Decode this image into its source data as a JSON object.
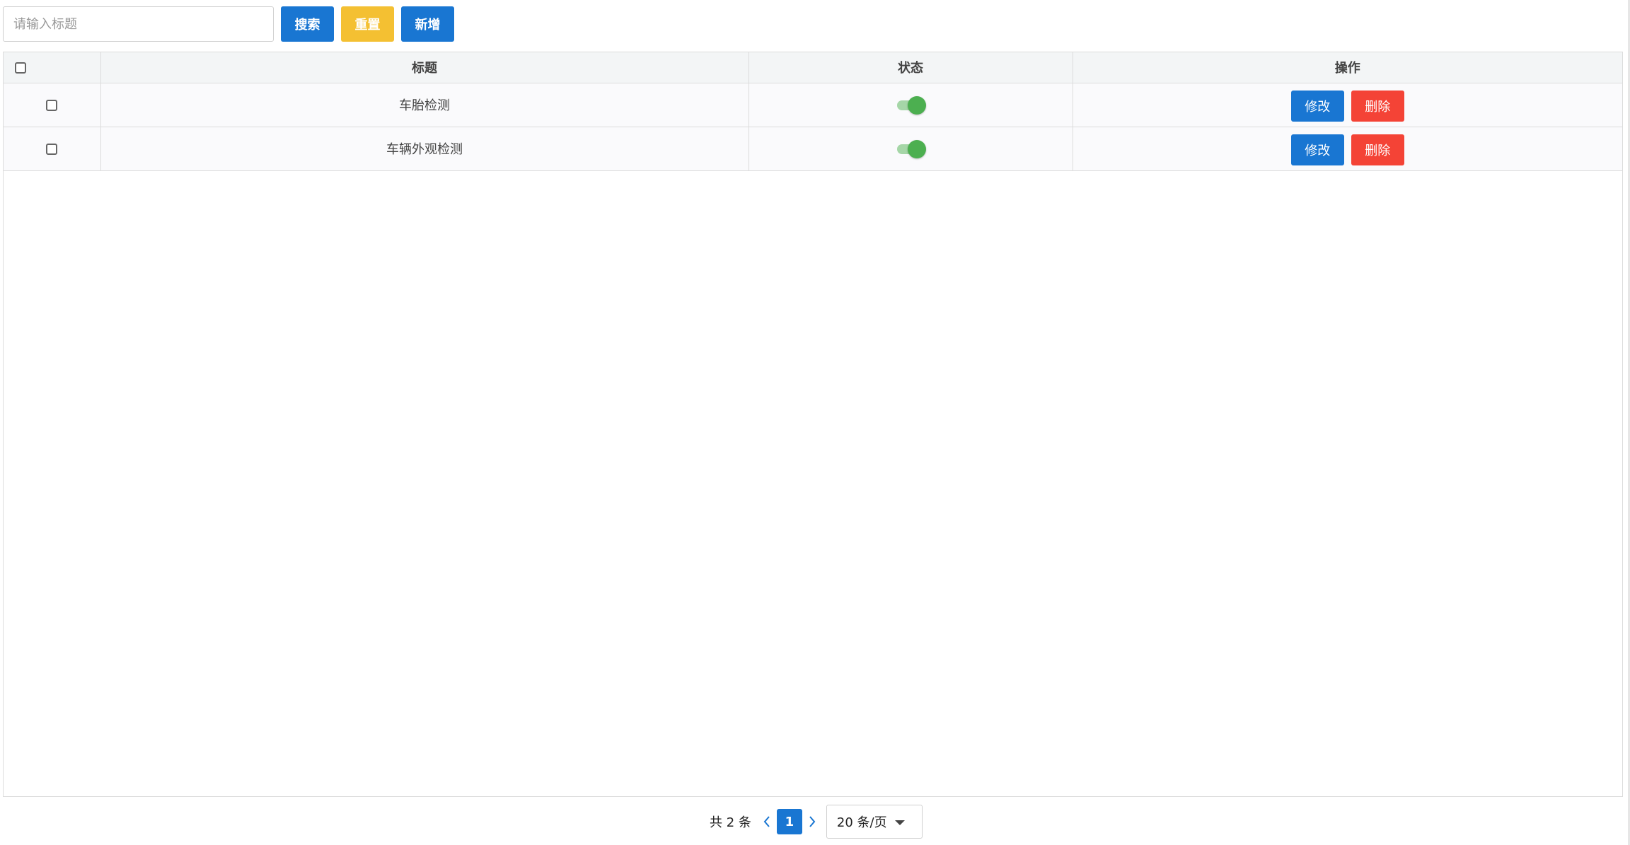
{
  "search": {
    "placeholder": "请输入标题",
    "value": ""
  },
  "toolbar": {
    "search_label": "搜索",
    "reset_label": "重置",
    "add_label": "新增"
  },
  "colors": {
    "primary": "#1976d2",
    "warning": "#f4c032",
    "danger": "#f44336",
    "switch_on": "#4caf50"
  },
  "table": {
    "columns": {
      "title": "标题",
      "status": "状态",
      "actions": "操作"
    },
    "rows": [
      {
        "checked": false,
        "title": "车胎检测",
        "status_on": true,
        "edit_label": "修改",
        "delete_label": "删除"
      },
      {
        "checked": false,
        "title": "车辆外观检测",
        "status_on": true,
        "edit_label": "修改",
        "delete_label": "删除"
      }
    ]
  },
  "pagination": {
    "total_text": "共 2 条",
    "current_page": "1",
    "page_size_text": "20 条/页",
    "prev_icon": "chevron-left-icon",
    "next_icon": "chevron-right-icon"
  }
}
